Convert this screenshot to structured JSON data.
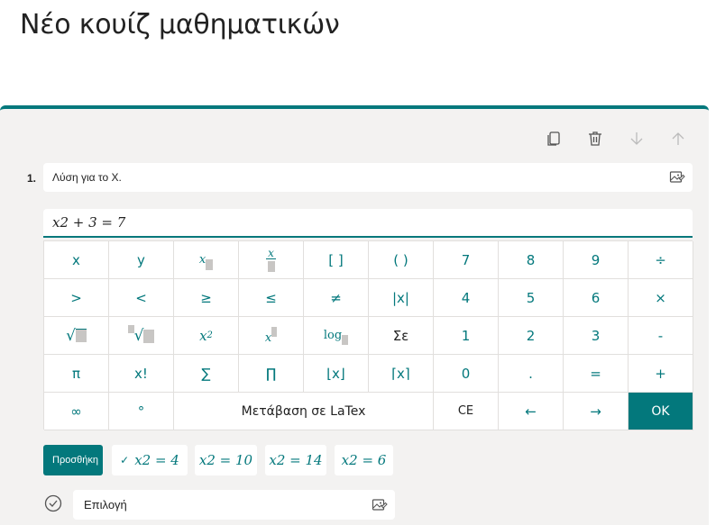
{
  "page": {
    "title": "Νέο κουίζ μαθηματικών"
  },
  "question": {
    "number": "1.",
    "text": "Λύση για το X.",
    "equation": "x2 + 3 = 7"
  },
  "keypad": {
    "rows": [
      [
        "x",
        "y",
        "",
        "",
        "[ ]",
        "( )",
        "7",
        "8",
        "9",
        "÷"
      ],
      [
        ">",
        "<",
        "≥",
        "≤",
        "≠",
        "|x|",
        "4",
        "5",
        "6",
        "×"
      ],
      [
        "",
        "",
        "",
        "",
        "log",
        "Σε",
        "1",
        "2",
        "3",
        "-"
      ],
      [
        "π",
        "x!",
        "∑",
        "∏",
        "⌊x⌋",
        "⌈x⌉",
        "0",
        ".",
        "=",
        "+"
      ]
    ],
    "last_row": {
      "infinity": "∞",
      "degree": "°",
      "latex": "Μετάβαση σε LaTex",
      "clear": "CE",
      "left": "←",
      "right": "→",
      "ok": "OK"
    }
  },
  "suggestions": {
    "add_label": "Προσθήκη",
    "chips": [
      "x2 = 4",
      "x2 = 10",
      "x2 = 14",
      "x2 = 6"
    ]
  },
  "option": {
    "placeholder": "Επιλογή"
  },
  "colors": {
    "accent": "#03787c",
    "card_bg": "#f3f2f1"
  },
  "icons": [
    "copy-icon",
    "trash-icon",
    "arrow-down-icon",
    "arrow-up-icon",
    "image-icon",
    "check-circle-icon"
  ]
}
